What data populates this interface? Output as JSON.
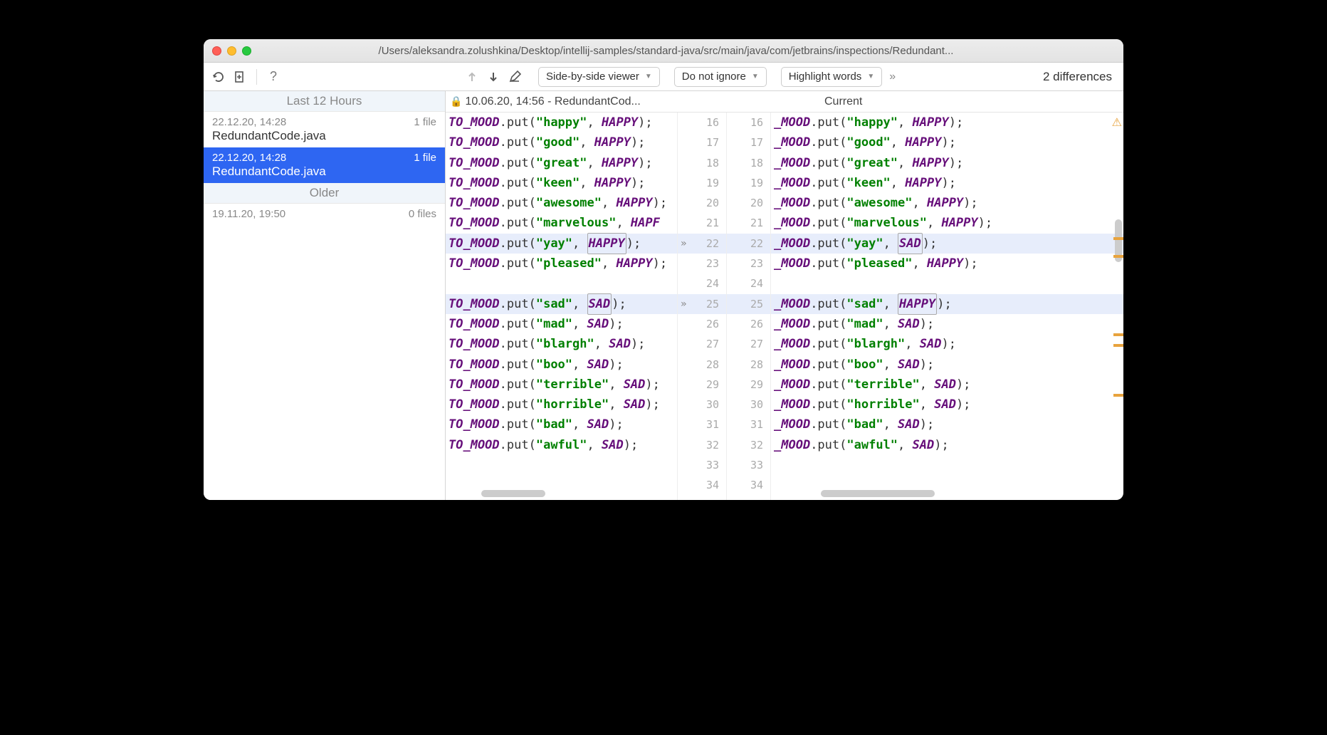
{
  "window": {
    "title": "/Users/aleksandra.zolushkina/Desktop/intellij-samples/standard-java/src/main/java/com/jetbrains/inspections/Redundant..."
  },
  "toolbar": {
    "viewer_mode": "Side-by-side viewer",
    "ignore_mode": "Do not ignore",
    "highlight_mode": "Highlight words",
    "diff_count": "2 differences"
  },
  "sidebar": {
    "sections": [
      {
        "title": "Last 12 Hours",
        "items": [
          {
            "date": "22.12.20, 14:28",
            "files": "1 file",
            "filename": "RedundantCode.java",
            "selected": false
          },
          {
            "date": "22.12.20, 14:28",
            "files": "1 file",
            "filename": "RedundantCode.java",
            "selected": true
          }
        ]
      },
      {
        "title": "Older",
        "items_simple": [
          {
            "date": "19.11.20, 19:50",
            "files": "0 files"
          }
        ]
      }
    ]
  },
  "diff_header": {
    "left_title": "10.06.20, 14:56 - RedundantCod...",
    "right_title": "Current"
  },
  "code": {
    "left_prefix": "TO_MOOD",
    "right_prefix": "_MOOD",
    "lines": [
      {
        "num": 16,
        "key": "happy",
        "left_val": "HAPPY",
        "right_val": "HAPPY"
      },
      {
        "num": 17,
        "key": "good",
        "left_val": "HAPPY",
        "right_val": "HAPPY"
      },
      {
        "num": 18,
        "key": "great",
        "left_val": "HAPPY",
        "right_val": "HAPPY"
      },
      {
        "num": 19,
        "key": "keen",
        "left_val": "HAPPY",
        "right_val": "HAPPY"
      },
      {
        "num": 20,
        "key": "awesome",
        "left_val": "HAPPY",
        "right_val": "HAPPY"
      },
      {
        "num": 21,
        "key": "marvelous",
        "left_val": "HAPPY",
        "right_val": "HAPPY",
        "left_truncated": true
      },
      {
        "num": 22,
        "key": "yay",
        "left_val": "HAPPY",
        "right_val": "SAD",
        "diff": true
      },
      {
        "num": 23,
        "key": "pleased",
        "left_val": "HAPPY",
        "right_val": "HAPPY"
      },
      {
        "num": 24,
        "blank": true
      },
      {
        "num": 25,
        "key": "sad",
        "left_val": "SAD",
        "right_val": "HAPPY",
        "diff": true
      },
      {
        "num": 26,
        "key": "mad",
        "left_val": "SAD",
        "right_val": "SAD"
      },
      {
        "num": 27,
        "key": "blargh",
        "left_val": "SAD",
        "right_val": "SAD"
      },
      {
        "num": 28,
        "key": "boo",
        "left_val": "SAD",
        "right_val": "SAD"
      },
      {
        "num": 29,
        "key": "terrible",
        "left_val": "SAD",
        "right_val": "SAD"
      },
      {
        "num": 30,
        "key": "horrible",
        "left_val": "SAD",
        "right_val": "SAD"
      },
      {
        "num": 31,
        "key": "bad",
        "left_val": "SAD",
        "right_val": "SAD"
      },
      {
        "num": 32,
        "key": "awful",
        "left_val": "SAD",
        "right_val": "SAD"
      },
      {
        "num": 33,
        "blank": true
      },
      {
        "num": 34,
        "blank": true
      }
    ]
  }
}
